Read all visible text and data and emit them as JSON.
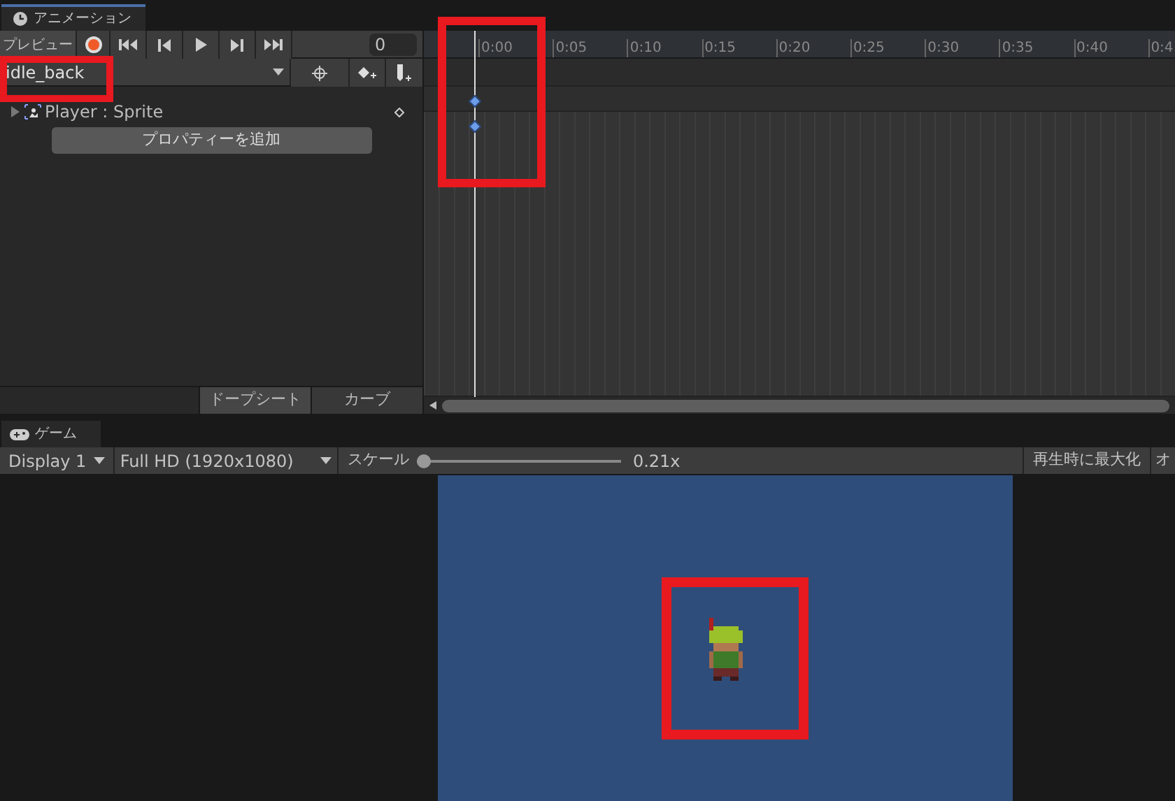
{
  "animation_tab": {
    "title": "アニメーション"
  },
  "toolbar": {
    "preview": "プレビュー",
    "recording": false,
    "frame": "0"
  },
  "clip": {
    "name": "idle_back"
  },
  "tracks": [
    {
      "name": "Player : Sprite",
      "expanded": false
    }
  ],
  "add_property": "プロパティーを追加",
  "view_tabs": [
    {
      "label": "ドープシート",
      "selected": true
    },
    {
      "label": "カーブ",
      "selected": false
    }
  ],
  "ruler": [
    "0:00",
    "0:05",
    "0:10",
    "0:15",
    "0:20",
    "0:25",
    "0:30",
    "0:35",
    "0:40",
    "0:4"
  ],
  "game_tab": {
    "title": "ゲーム"
  },
  "game_toolbar": {
    "display": "Display 1",
    "resolution": "Full HD (1920x1080)",
    "scale_label": "スケール",
    "scale": {
      "level": 0.0
    },
    "scale_reading": "0.21x",
    "maximize": "再生時に最大化",
    "cut_button": "オ"
  }
}
